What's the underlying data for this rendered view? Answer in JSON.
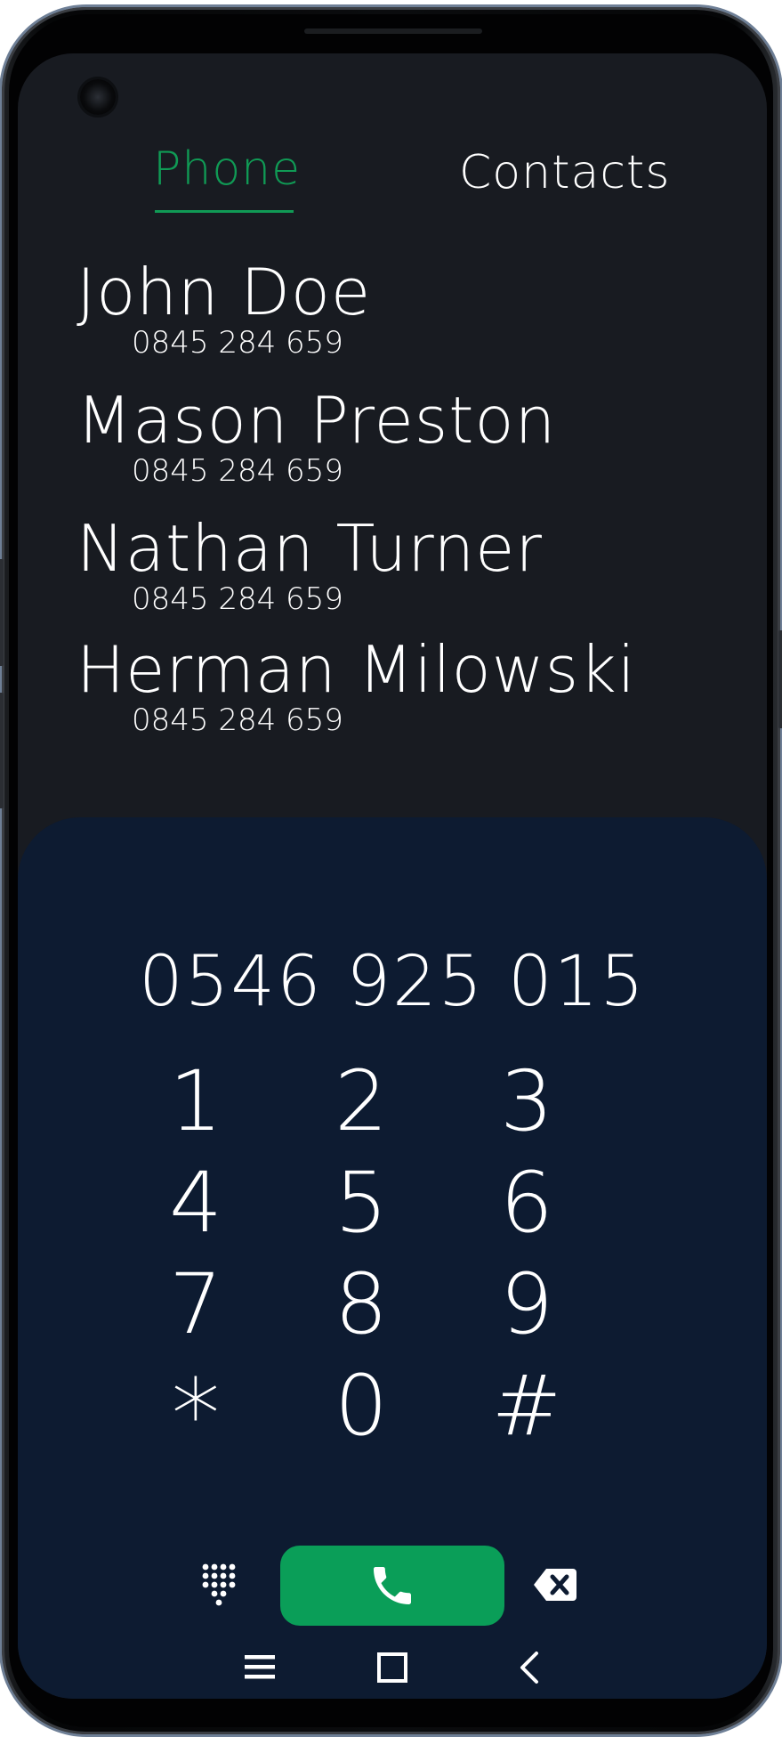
{
  "tabs": {
    "phone": "Phone",
    "contacts": "Contacts",
    "active": "phone"
  },
  "contacts": [
    {
      "name": "John Doe",
      "number": "0845 284 659"
    },
    {
      "name": "Mason Preston",
      "number": "0845 284 659"
    },
    {
      "name": "Nathan Turner",
      "number": "0845 284 659"
    },
    {
      "name": "Herman Milowski",
      "number": "0845 284 659"
    }
  ],
  "dialer": {
    "number": "0546 925 015",
    "keys": [
      "1",
      "2",
      "3",
      "4",
      "5",
      "6",
      "7",
      "8",
      "9",
      "*",
      "0",
      "#"
    ]
  },
  "actions": {
    "dialpad_icon": "dialpad-icon",
    "call_icon": "phone-icon",
    "backspace_icon": "backspace-icon"
  },
  "nav": {
    "menu_icon": "menu-icon",
    "home_icon": "square-icon",
    "back_icon": "chevron-left-icon"
  },
  "colors": {
    "accent": "#109a55",
    "call_button": "#0a9e58",
    "background": "#181b21",
    "dial_panel": "#0d1b31",
    "text": "#ffffff"
  }
}
